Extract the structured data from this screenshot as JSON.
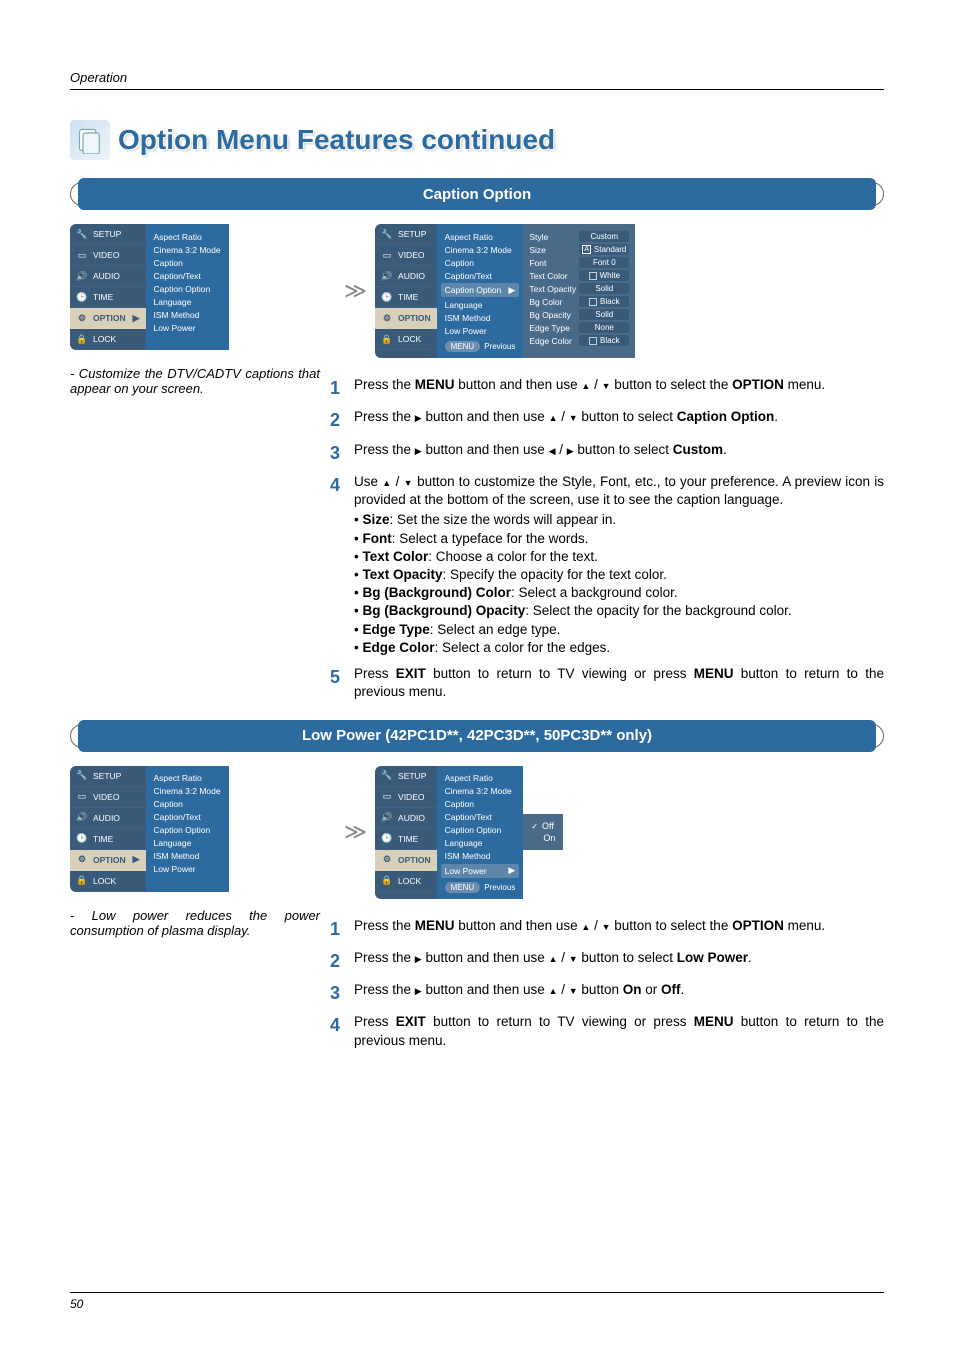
{
  "header": {
    "section_label": "Operation",
    "page_number": "50"
  },
  "title": "Option Menu Features continued",
  "banner1": "Caption Option",
  "banner2": "Low Power (42PC1D**, 42PC3D**, 50PC3D** only)",
  "nav_items": [
    "SETUP",
    "VIDEO",
    "AUDIO",
    "TIME",
    "OPTION",
    "LOCK"
  ],
  "option_list": [
    "Aspect Ratio",
    "Cinema 3:2 Mode",
    "Caption",
    "Caption/Text",
    "Caption Option",
    "Language",
    "ISM Method",
    "Low Power"
  ],
  "menu_prev": {
    "menu": "MENU",
    "prev": "Previous"
  },
  "style_panel": {
    "rows": [
      {
        "label": "Style",
        "value": "Custom"
      },
      {
        "label": "Size",
        "value": "Standard",
        "icon": "A"
      },
      {
        "label": "Font",
        "value": "Font  0"
      },
      {
        "label": "Text Color",
        "value": "White",
        "swatch": true
      },
      {
        "label": "Text Opacity",
        "value": "Solid"
      },
      {
        "label": "Bg Color",
        "value": "Black",
        "swatch": true
      },
      {
        "label": "Bg Opacity",
        "value": "Solid"
      },
      {
        "label": "Edge Type",
        "value": "None"
      },
      {
        "label": "Edge Color",
        "value": "Black",
        "swatch": true
      }
    ]
  },
  "lp_values": {
    "off": "Off",
    "on": "On"
  },
  "notes": {
    "caption": "- Customize the DTV/CADTV captions that appear on your screen.",
    "lowpower": "- Low power reduces the power consumption of plasma display."
  },
  "steps1": {
    "s1a": "Press the ",
    "s1_menu": "MENU",
    "s1b": " button and then use ",
    "s1c": "  button to select the ",
    "s1_option": "OPTION",
    "s1d": " menu.",
    "s2a": "Press the ",
    "s2b": " button and then use ",
    "s2c": " button to select ",
    "s2_target": "Caption Option",
    "s2d": ".",
    "s3a": "Press the ",
    "s3b": " button and then use ",
    "s3c": " button to select ",
    "s3_target": "Custom",
    "s3d": ".",
    "s4a": "Use ",
    "s4b": " button to customize the Style, Font, etc., to your preference. A preview icon is provided at the bottom of the screen, use it to see the caption language.",
    "bullets": [
      {
        "b": "Size",
        "t": ": Set the size the words will appear in."
      },
      {
        "b": "Font",
        "t": ": Select a typeface for the words."
      },
      {
        "b": "Text Color",
        "t": ": Choose a color for the text."
      },
      {
        "b": "Text Opacity",
        "t": ": Specify the opacity for the text color."
      },
      {
        "b": "Bg (Background) Color",
        "t": ": Select a background color."
      },
      {
        "b": "Bg (Background) Opacity",
        "t": ": Select the opacity for the background color."
      },
      {
        "b": "Edge Type",
        "t": ": Select an edge type."
      },
      {
        "b": "Edge Color",
        "t": ": Select a color for the edges."
      }
    ],
    "s5a": "Press ",
    "s5_exit": "EXIT",
    "s5b": " button to return to TV viewing or press ",
    "s5_menu": "MENU",
    "s5c": " button to return to the previous menu."
  },
  "steps2": {
    "s1a": "Press the ",
    "s1_menu": "MENU",
    "s1b": " button and then use ",
    "s1c": "  button to select the ",
    "s1_option": "OPTION",
    "s1d": " menu.",
    "s2a": "Press the ",
    "s2b": " button and then use ",
    "s2c": " button to select ",
    "s2_target": "Low Power",
    "s2d": ".",
    "s3a": "Press the ",
    "s3b": " button and then use ",
    "s3c": " button ",
    "s3_on": "On",
    "s3_or": " or ",
    "s3_off": "Off",
    "s3d": ".",
    "s4a": "Press ",
    "s4_exit": "EXIT",
    "s4b": " button to return to TV viewing or press ",
    "s4_menu": "MENU",
    "s4c": " button to return to the previous menu."
  }
}
